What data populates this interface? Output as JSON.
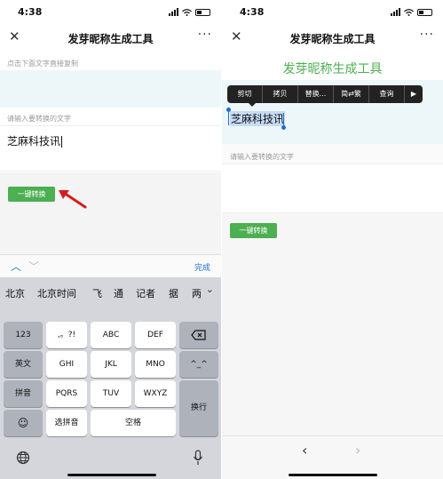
{
  "status": {
    "time": "4:38"
  },
  "nav": {
    "title": "发芽昵称生成工具",
    "close_icon": "close-icon",
    "more": "···"
  },
  "left": {
    "output_hint": "点击下面文字直接复制",
    "input_hint": "请输入要转换的文字",
    "input_value": "芝麻科技讯",
    "convert_button": "一键转换",
    "toolbar_done": "完成",
    "candidates": [
      "北京",
      "北京时间",
      "飞",
      "通",
      "记者",
      "据",
      "两"
    ],
    "keys": {
      "row1": [
        "123",
        ",。?!",
        "ABC",
        "DEF"
      ],
      "row2": [
        "英文",
        "GHI",
        "JKL",
        "MNO",
        "^_^"
      ],
      "row3": [
        "拼音",
        "PQRS",
        "TUV",
        "WXYZ"
      ],
      "row4": [
        "选拼音",
        "空格"
      ],
      "enter": "换行"
    }
  },
  "right": {
    "heading": "发芽昵称生成工具",
    "menu": [
      "剪切",
      "拷贝",
      "替换...",
      "简⇄繁",
      "查询",
      "▶"
    ],
    "selected_text": "芝麻科技讯",
    "input_hint": "请输入要转换的文字",
    "convert_button": "一键转换"
  },
  "colors": {
    "accent_green": "#4caf50",
    "ios_blue": "#1f6fd0",
    "output_bg": "#edf7fa"
  }
}
